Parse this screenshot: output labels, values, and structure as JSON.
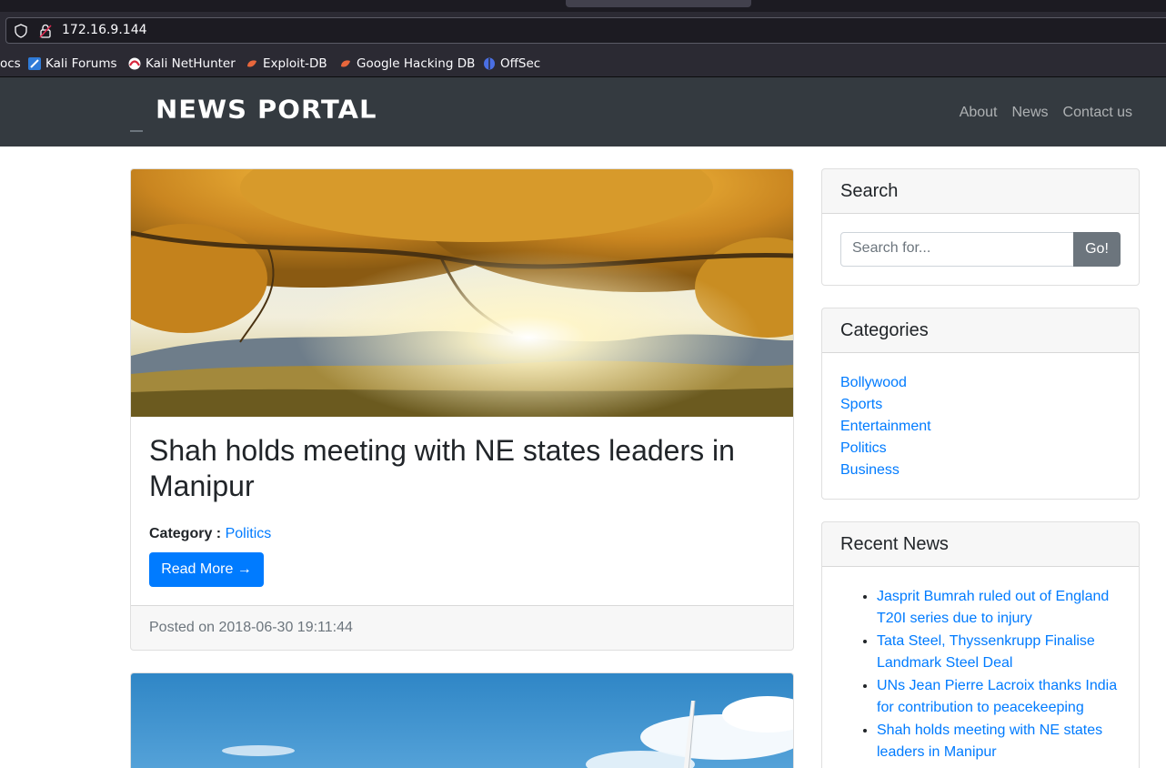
{
  "browser": {
    "url": "172.16.9.144",
    "bookmarks": [
      {
        "label": "ocs",
        "icon": "doc-icon"
      },
      {
        "label": "Kali Forums",
        "icon": "kali-forums-icon"
      },
      {
        "label": "Kali NetHunter",
        "icon": "nethunter-icon"
      },
      {
        "label": "Exploit-DB",
        "icon": "exploit-db-icon"
      },
      {
        "label": "Google Hacking DB",
        "icon": "ghdb-icon"
      },
      {
        "label": "OffSec",
        "icon": "offsec-icon"
      }
    ]
  },
  "site": {
    "logo": "NEWS PORTAL",
    "nav": [
      "About",
      "News",
      "Contact us"
    ]
  },
  "posts": [
    {
      "title": "Shah holds meeting with NE states leaders in Manipur",
      "category_label": "Category :",
      "category": "Politics",
      "read_more": "Read More →",
      "posted": "Posted on 2018-06-30 19:11:44"
    }
  ],
  "sidebar": {
    "search": {
      "title": "Search",
      "placeholder": "Search for...",
      "button": "Go!"
    },
    "categories": {
      "title": "Categories",
      "items": [
        "Bollywood",
        "Sports",
        "Entertainment",
        "Politics",
        "Business"
      ]
    },
    "recent": {
      "title": "Recent News",
      "items": [
        "Jasprit Bumrah ruled out of England T20I series due to injury",
        "Tata Steel, Thyssenkrupp Finalise Landmark Steel Deal",
        "UNs Jean Pierre Lacroix thanks India for contribution to peacekeeping",
        "Shah holds meeting with NE states leaders in Manipur"
      ]
    }
  },
  "colors": {
    "link": "#007bff",
    "navbar": "#343a40",
    "button_primary": "#007bff",
    "button_secondary": "#6c757d"
  }
}
